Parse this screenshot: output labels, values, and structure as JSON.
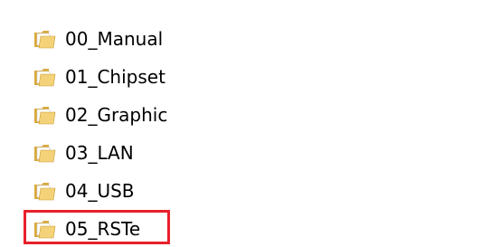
{
  "folders": [
    {
      "label": "00_Manual",
      "icon": "folder-icon"
    },
    {
      "label": "01_Chipset",
      "icon": "folder-icon"
    },
    {
      "label": "02_Graphic",
      "icon": "folder-icon"
    },
    {
      "label": "03_LAN",
      "icon": "folder-icon"
    },
    {
      "label": "04_USB",
      "icon": "folder-icon"
    },
    {
      "label": "05_RSTe",
      "icon": "folder-icon"
    }
  ],
  "highlighted_item": "05_RSTe",
  "colors": {
    "highlight_border": "#e8202a",
    "folder_front": "#f3d27a",
    "folder_back": "#d9a93c",
    "paper": "#ffffff"
  }
}
